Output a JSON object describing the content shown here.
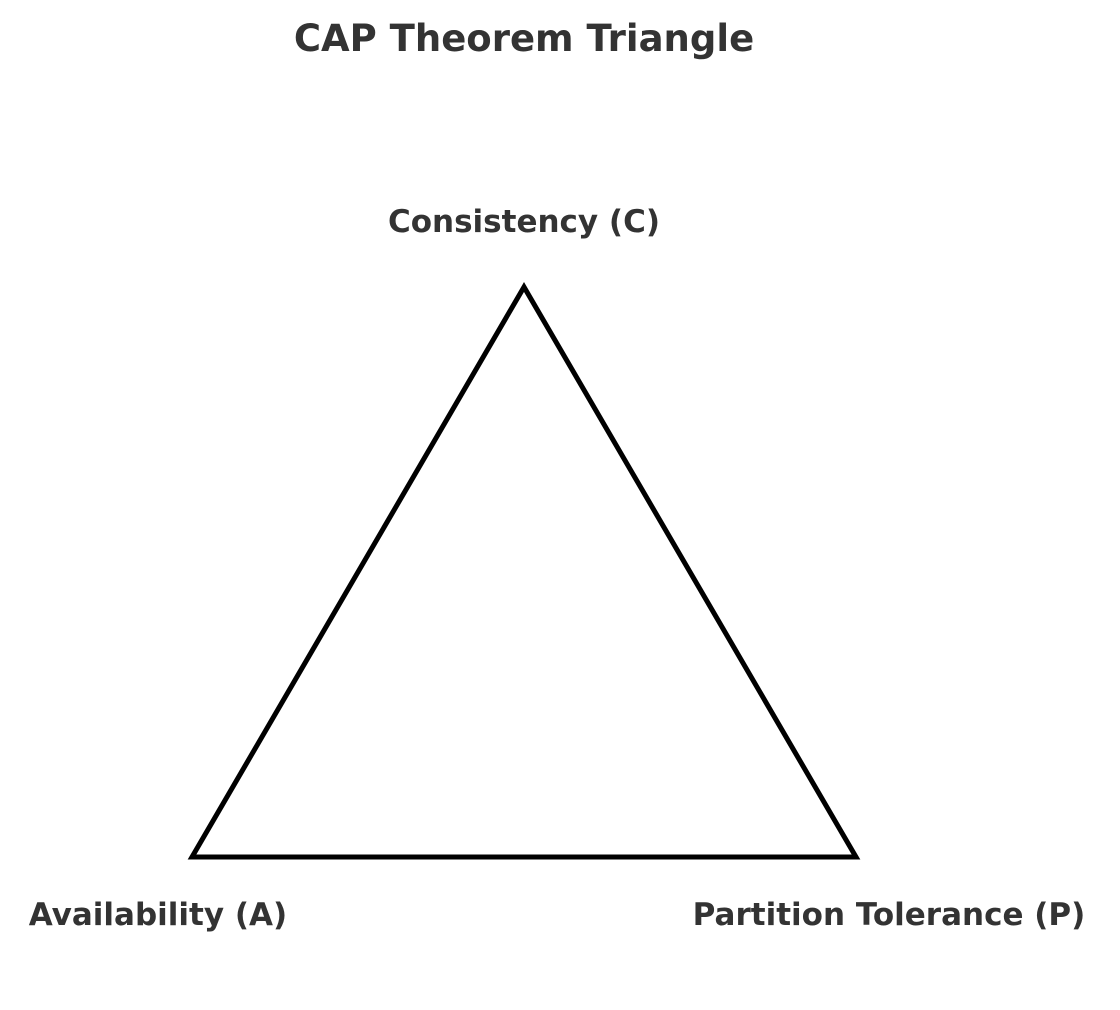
{
  "title": "CAP Theorem Triangle",
  "vertices": {
    "consistency": "Consistency (C)",
    "availability": "Availability (A)",
    "partition_tolerance": "Partition Tolerance (P)"
  },
  "colors": {
    "text": "#333333",
    "outline": "#000000",
    "background": "#ffffff"
  }
}
